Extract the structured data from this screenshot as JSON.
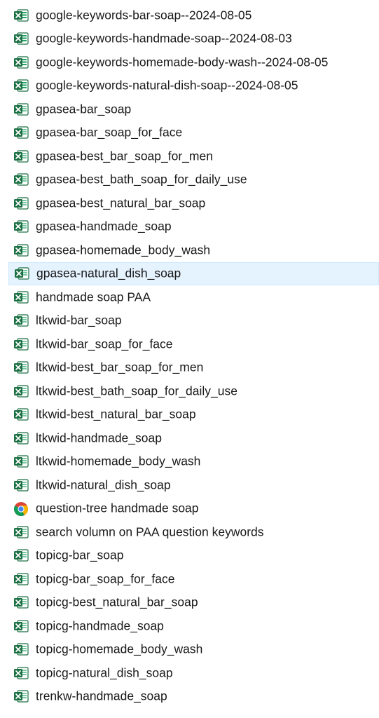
{
  "files": [
    {
      "name": "google-keywords-bar-soap--2024-08-05",
      "type": "excel-csv"
    },
    {
      "name": "google-keywords-handmade-soap--2024-08-03",
      "type": "excel-csv"
    },
    {
      "name": "google-keywords-homemade-body-wash--2024-08-05",
      "type": "excel-csv"
    },
    {
      "name": "google-keywords-natural-dish-soap--2024-08-05",
      "type": "excel-csv"
    },
    {
      "name": "gpasea-bar_soap",
      "type": "excel"
    },
    {
      "name": "gpasea-bar_soap_for_face",
      "type": "excel"
    },
    {
      "name": "gpasea-best_bar_soap_for_men",
      "type": "excel"
    },
    {
      "name": "gpasea-best_bath_soap_for_daily_use",
      "type": "excel"
    },
    {
      "name": "gpasea-best_natural_bar_soap",
      "type": "excel"
    },
    {
      "name": "gpasea-handmade_soap",
      "type": "excel"
    },
    {
      "name": "gpasea-homemade_body_wash",
      "type": "excel"
    },
    {
      "name": "gpasea-natural_dish_soap",
      "type": "excel",
      "selected": true
    },
    {
      "name": "handmade soap PAA",
      "type": "excel"
    },
    {
      "name": "ltkwid-bar_soap",
      "type": "excel"
    },
    {
      "name": "ltkwid-bar_soap_for_face",
      "type": "excel"
    },
    {
      "name": "ltkwid-best_bar_soap_for_men",
      "type": "excel"
    },
    {
      "name": "ltkwid-best_bath_soap_for_daily_use",
      "type": "excel"
    },
    {
      "name": "ltkwid-best_natural_bar_soap",
      "type": "excel"
    },
    {
      "name": "ltkwid-handmade_soap",
      "type": "excel"
    },
    {
      "name": "ltkwid-homemade_body_wash",
      "type": "excel"
    },
    {
      "name": "ltkwid-natural_dish_soap",
      "type": "excel"
    },
    {
      "name": "question-tree handmade soap",
      "type": "chrome"
    },
    {
      "name": "search volumn on PAA question keywords",
      "type": "excel"
    },
    {
      "name": "topicg-bar_soap",
      "type": "excel"
    },
    {
      "name": "topicg-bar_soap_for_face",
      "type": "excel"
    },
    {
      "name": "topicg-best_natural_bar_soap",
      "type": "excel"
    },
    {
      "name": "topicg-handmade_soap",
      "type": "excel"
    },
    {
      "name": "topicg-homemade_body_wash",
      "type": "excel"
    },
    {
      "name": "topicg-natural_dish_soap",
      "type": "excel"
    },
    {
      "name": "trenkw-handmade_soap",
      "type": "excel"
    }
  ],
  "icons": {
    "excel-csv": "excel-csv-file-icon",
    "excel": "excel-file-icon",
    "chrome": "chrome-icon"
  },
  "colors": {
    "selection_background": "#e5f3ff",
    "selection_border": "#cce8ff",
    "excel_green": "#1d7044",
    "excel_light": "#21a366"
  }
}
